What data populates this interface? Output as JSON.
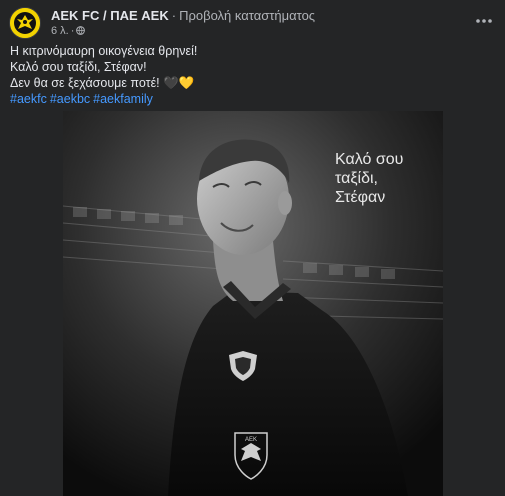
{
  "post": {
    "page_name": "AEK FC / ΠΑΕ AEK",
    "separator": "·",
    "store_link": "Προβολή καταστήματος",
    "time": "6 λ.",
    "meta_dot": "·",
    "privacy_icon": "globe-icon",
    "more_icon": "more-options-icon",
    "text_lines": [
      "Η κιτρινόμαυρη οικογένεια θρηνεί!",
      "Καλό σου ταξίδι, Στέφαν!",
      "Δεν θα σε ξεχάσουμε ποτέ!"
    ],
    "hearts": [
      "🖤",
      "💛"
    ],
    "hashtags": [
      "#aekfc",
      "#aekbc",
      "#aekfamily"
    ]
  },
  "image": {
    "overlay_lines": [
      "Καλό σου",
      "ταξίδι,",
      "Στέφαν"
    ],
    "logo_text": "AEK"
  },
  "colors": {
    "background": "#242526",
    "text": "#e4e6eb",
    "secondary": "#b0b3b8",
    "link": "#4599ff",
    "brand_yellow": "#f2d200"
  }
}
